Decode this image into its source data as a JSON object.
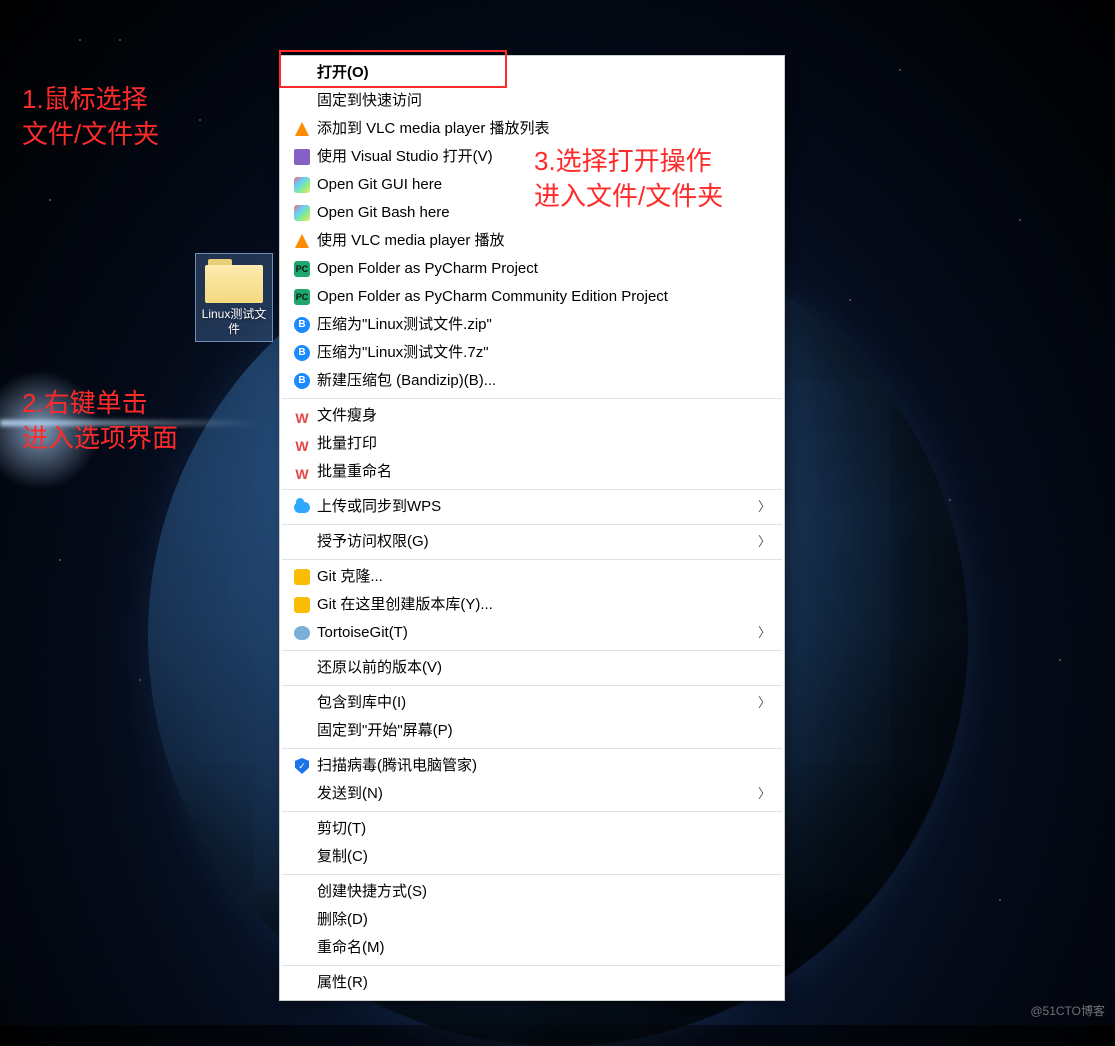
{
  "desktop": {
    "folder_label": "Linux测试文件"
  },
  "annotations": {
    "a1": "1.鼠标选择\n文件/文件夹",
    "a2": "2.右键单击\n进入选项界面",
    "a3": "3.选择打开操作\n进入文件/文件夹"
  },
  "watermark": "@51CTO博客",
  "menu": {
    "groups": [
      [
        {
          "id": "open",
          "label": "打开(O)",
          "icon": "",
          "bold": true,
          "sub": false
        },
        {
          "id": "pin-quick",
          "label": "固定到快速访问",
          "icon": "",
          "bold": false,
          "sub": false
        },
        {
          "id": "vlc-add",
          "label": "添加到 VLC media player 播放列表",
          "icon": "vlc",
          "bold": false,
          "sub": false
        },
        {
          "id": "vs-open",
          "label": "使用 Visual Studio 打开(V)",
          "icon": "vs",
          "bold": false,
          "sub": false
        },
        {
          "id": "git-gui",
          "label": "Open Git GUI here",
          "icon": "git",
          "bold": false,
          "sub": false
        },
        {
          "id": "git-bash",
          "label": "Open Git Bash here",
          "icon": "git",
          "bold": false,
          "sub": false
        },
        {
          "id": "vlc-play",
          "label": "使用 VLC media player 播放",
          "icon": "vlc",
          "bold": false,
          "sub": false
        },
        {
          "id": "pycharm",
          "label": "Open Folder as PyCharm Project",
          "icon": "pc",
          "bold": false,
          "sub": false
        },
        {
          "id": "pycharm-ce",
          "label": "Open Folder as PyCharm Community Edition Project",
          "icon": "pc",
          "bold": false,
          "sub": false
        },
        {
          "id": "bz-zip",
          "label": "压缩为\"Linux测试文件.zip\"",
          "icon": "bz",
          "bold": false,
          "sub": false
        },
        {
          "id": "bz-7z",
          "label": "压缩为\"Linux测试文件.7z\"",
          "icon": "bz",
          "bold": false,
          "sub": false
        },
        {
          "id": "bz-new",
          "label": "新建压缩包 (Bandizip)(B)...",
          "icon": "bz",
          "bold": false,
          "sub": false
        }
      ],
      [
        {
          "id": "wps-slim",
          "label": "文件瘦身",
          "icon": "wps",
          "bold": false,
          "sub": false
        },
        {
          "id": "wps-print",
          "label": "批量打印",
          "icon": "wps",
          "bold": false,
          "sub": false
        },
        {
          "id": "wps-rename",
          "label": "批量重命名",
          "icon": "wps",
          "bold": false,
          "sub": false
        }
      ],
      [
        {
          "id": "wps-upload",
          "label": "上传或同步到WPS",
          "icon": "cloud",
          "bold": false,
          "sub": true
        }
      ],
      [
        {
          "id": "grant-access",
          "label": "授予访问权限(G)",
          "icon": "",
          "bold": false,
          "sub": true
        }
      ],
      [
        {
          "id": "git-clone",
          "label": "Git 克隆...",
          "icon": "gitc",
          "bold": false,
          "sub": false
        },
        {
          "id": "git-repo",
          "label": "Git 在这里创建版本库(Y)...",
          "icon": "gitc",
          "bold": false,
          "sub": false
        },
        {
          "id": "tortoise",
          "label": "TortoiseGit(T)",
          "icon": "tort",
          "bold": false,
          "sub": true
        }
      ],
      [
        {
          "id": "restore-prev",
          "label": "还原以前的版本(V)",
          "icon": "",
          "bold": false,
          "sub": false
        }
      ],
      [
        {
          "id": "include-lib",
          "label": "包含到库中(I)",
          "icon": "",
          "bold": false,
          "sub": true
        },
        {
          "id": "pin-start",
          "label": "固定到\"开始\"屏幕(P)",
          "icon": "",
          "bold": false,
          "sub": false
        }
      ],
      [
        {
          "id": "scan-virus",
          "label": "扫描病毒(腾讯电脑管家)",
          "icon": "shield",
          "bold": false,
          "sub": false
        },
        {
          "id": "send-to",
          "label": "发送到(N)",
          "icon": "",
          "bold": false,
          "sub": true
        }
      ],
      [
        {
          "id": "cut",
          "label": "剪切(T)",
          "icon": "",
          "bold": false,
          "sub": false
        },
        {
          "id": "copy",
          "label": "复制(C)",
          "icon": "",
          "bold": false,
          "sub": false
        }
      ],
      [
        {
          "id": "shortcut",
          "label": "创建快捷方式(S)",
          "icon": "",
          "bold": false,
          "sub": false
        },
        {
          "id": "delete",
          "label": "删除(D)",
          "icon": "",
          "bold": false,
          "sub": false
        },
        {
          "id": "rename",
          "label": "重命名(M)",
          "icon": "",
          "bold": false,
          "sub": false
        }
      ],
      [
        {
          "id": "properties",
          "label": "属性(R)",
          "icon": "",
          "bold": false,
          "sub": false
        }
      ]
    ]
  }
}
